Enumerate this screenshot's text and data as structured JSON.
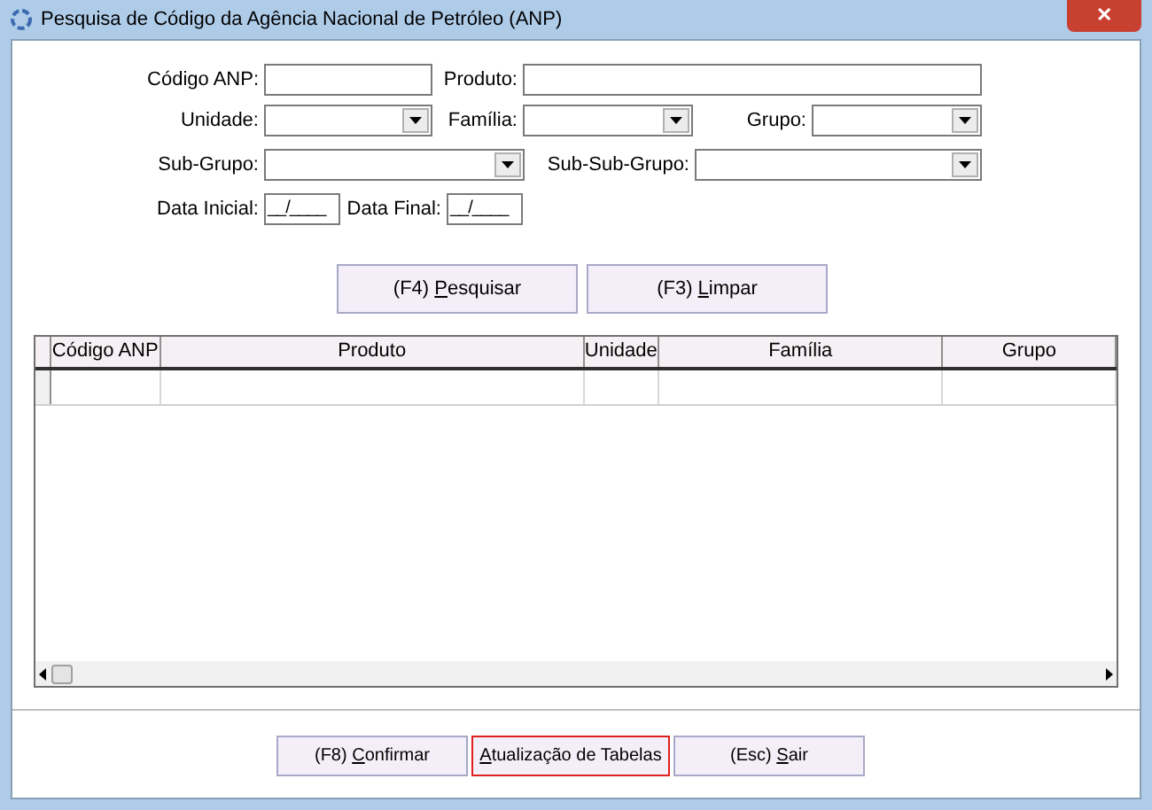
{
  "window": {
    "title": "Pesquisa de Código da Agência Nacional de Petróleo (ANP)",
    "close": "✕"
  },
  "filters": {
    "codigo_anp": {
      "label": "Código ANP:"
    },
    "produto": {
      "label": "Produto:"
    },
    "unidade": {
      "label": "Unidade:"
    },
    "familia": {
      "label": "Família:"
    },
    "grupo": {
      "label": "Grupo:"
    },
    "sub_grupo": {
      "label": "Sub-Grupo:"
    },
    "sub_sub_grupo": {
      "label": "Sub-Sub-Grupo:"
    },
    "data_inicial": {
      "label": "Data Inicial:",
      "value": "__/____"
    },
    "data_final": {
      "label": "Data Final:",
      "value": "__/____"
    }
  },
  "search_buttons": [
    {
      "prefix": "(F4) ",
      "mnemonic": "P",
      "rest": "esquisar",
      "focused": false
    },
    {
      "prefix": "(F3) ",
      "mnemonic": "L",
      "rest": "impar",
      "focused": false
    }
  ],
  "table": {
    "columns": [
      "Código ANP",
      "Produto",
      "Unidade",
      "Família",
      "Grupo"
    ]
  },
  "bottom_buttons": [
    {
      "prefix": "(F8) ",
      "mnemonic": "C",
      "rest": "onfirmar",
      "focused": false
    },
    {
      "mnemonic": "A",
      "rest": "tualização de Tabelas",
      "focused": true
    },
    {
      "prefix": "(Esc) ",
      "mnemonic": "S",
      "rest": "air",
      "focused": false
    }
  ]
}
